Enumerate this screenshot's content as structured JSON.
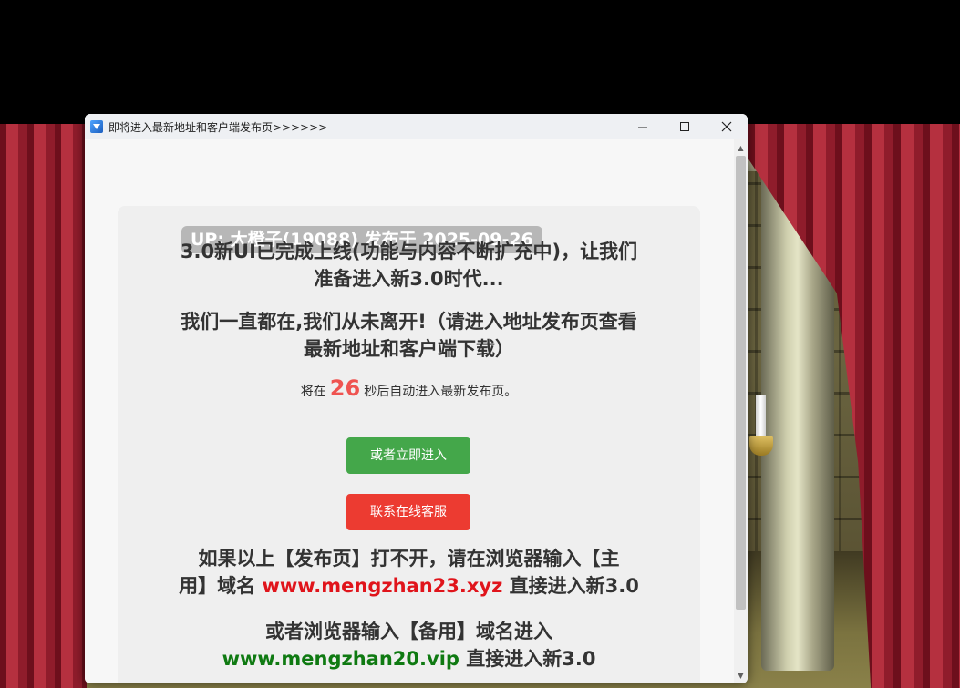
{
  "window": {
    "title": "即将进入最新地址和客户端发布页>>>>>>",
    "controls": [
      "minimize",
      "maximize",
      "close"
    ]
  },
  "notice": {
    "badge": "UP: 大橙子(19088) 发布于 2025-09-26",
    "line1": "3.0新UI已完成上线(功能与内容不断扩充中)，让我们",
    "line2": "准备进入新3.0时代...",
    "line3": "我们一直都在,我们从未离开!（请进入地址发布页查看",
    "line4": "最新地址和客户端下载）",
    "countdown_prefix": "将在",
    "countdown_value": "26",
    "countdown_suffix": "秒后自动进入最新发布页。",
    "enter_button": "或者立即进入",
    "service_button": "联系在线客服",
    "line5": "如果以上【发布页】打不开，请在浏览器输入【主",
    "line6_prefix": "用】域名",
    "primary_domain": "www.mengzhan23.xyz",
    "line6_suffix": "直接进入新3.0",
    "line7": "或者浏览器输入【备用】域名进入",
    "backup_domain": "www.mengzhan20.vip",
    "line8_suffix": "直接进入新3.0"
  },
  "colors": {
    "enter_button": "#44a74a",
    "service_button": "#ec3b31",
    "countdown": "#ef5350",
    "primary_domain": "#e0141b",
    "backup_domain": "#0f7a12"
  }
}
